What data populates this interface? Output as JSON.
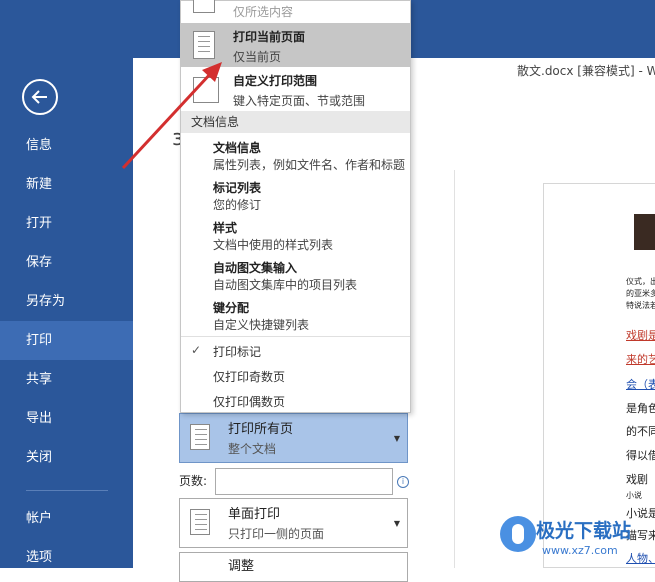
{
  "document": {
    "title": "散文.docx [兼容模式] - W"
  },
  "sidebar": {
    "items": [
      {
        "label": "信息"
      },
      {
        "label": "新建"
      },
      {
        "label": "打开"
      },
      {
        "label": "保存"
      },
      {
        "label": "另存为"
      },
      {
        "label": "打印",
        "active": true
      },
      {
        "label": "共享"
      },
      {
        "label": "导出"
      },
      {
        "label": "关闭"
      },
      {
        "label": "帐户"
      },
      {
        "label": "选项"
      }
    ]
  },
  "print_settings": {
    "pages_select": {
      "title": "打印所有页",
      "sub": "整个文档"
    },
    "pages_label": "页数:",
    "pages_value": "",
    "sides_select": {
      "title": "单面打印",
      "sub": "只打印一侧的页面"
    },
    "adjust_label": "调整"
  },
  "dropdown": {
    "options": [
      {
        "desc": "仅所选内容"
      },
      {
        "title": "打印当前页面",
        "desc": "仅当前页"
      },
      {
        "title": "自定义打印范围",
        "desc": "键入特定页面、节或范围"
      }
    ],
    "section_label": "文档信息",
    "items": [
      {
        "title": "文档信息",
        "desc": "属性列表，例如文件名、作者和标题"
      },
      {
        "title": "标记列表",
        "desc": "您的修订"
      },
      {
        "title": "样式",
        "desc": "文档中使用的样式列表"
      },
      {
        "title": "自动图文集输入",
        "desc": "自动图文集库中的项目列表"
      },
      {
        "title": "键分配",
        "desc": "自定义快捷键列表"
      }
    ],
    "toggles": [
      "打印标记",
      "仅打印奇数页",
      "仅打印偶数页"
    ],
    "check_glyph": "✓"
  },
  "page_header_glyph": "з",
  "preview": {
    "lines": [
      "仪式，出",
      "的亚米多",
      "特说法若",
      "戏剧是",
      "来的艺",
      "会（表",
      "是角色",
      "的不同",
      "得以借",
      "戏剧",
      "小说",
      "小说是",
      "描写来",
      "人物、"
    ]
  },
  "watermark": {
    "title": "极光下载站",
    "url": "www.xz7.com"
  },
  "colors": {
    "accent": "#2b579a",
    "active": "#3d6cb4",
    "selected": "#a9c4e8",
    "highlight": "#c6c6c6",
    "arrow": "#d32f2f"
  }
}
